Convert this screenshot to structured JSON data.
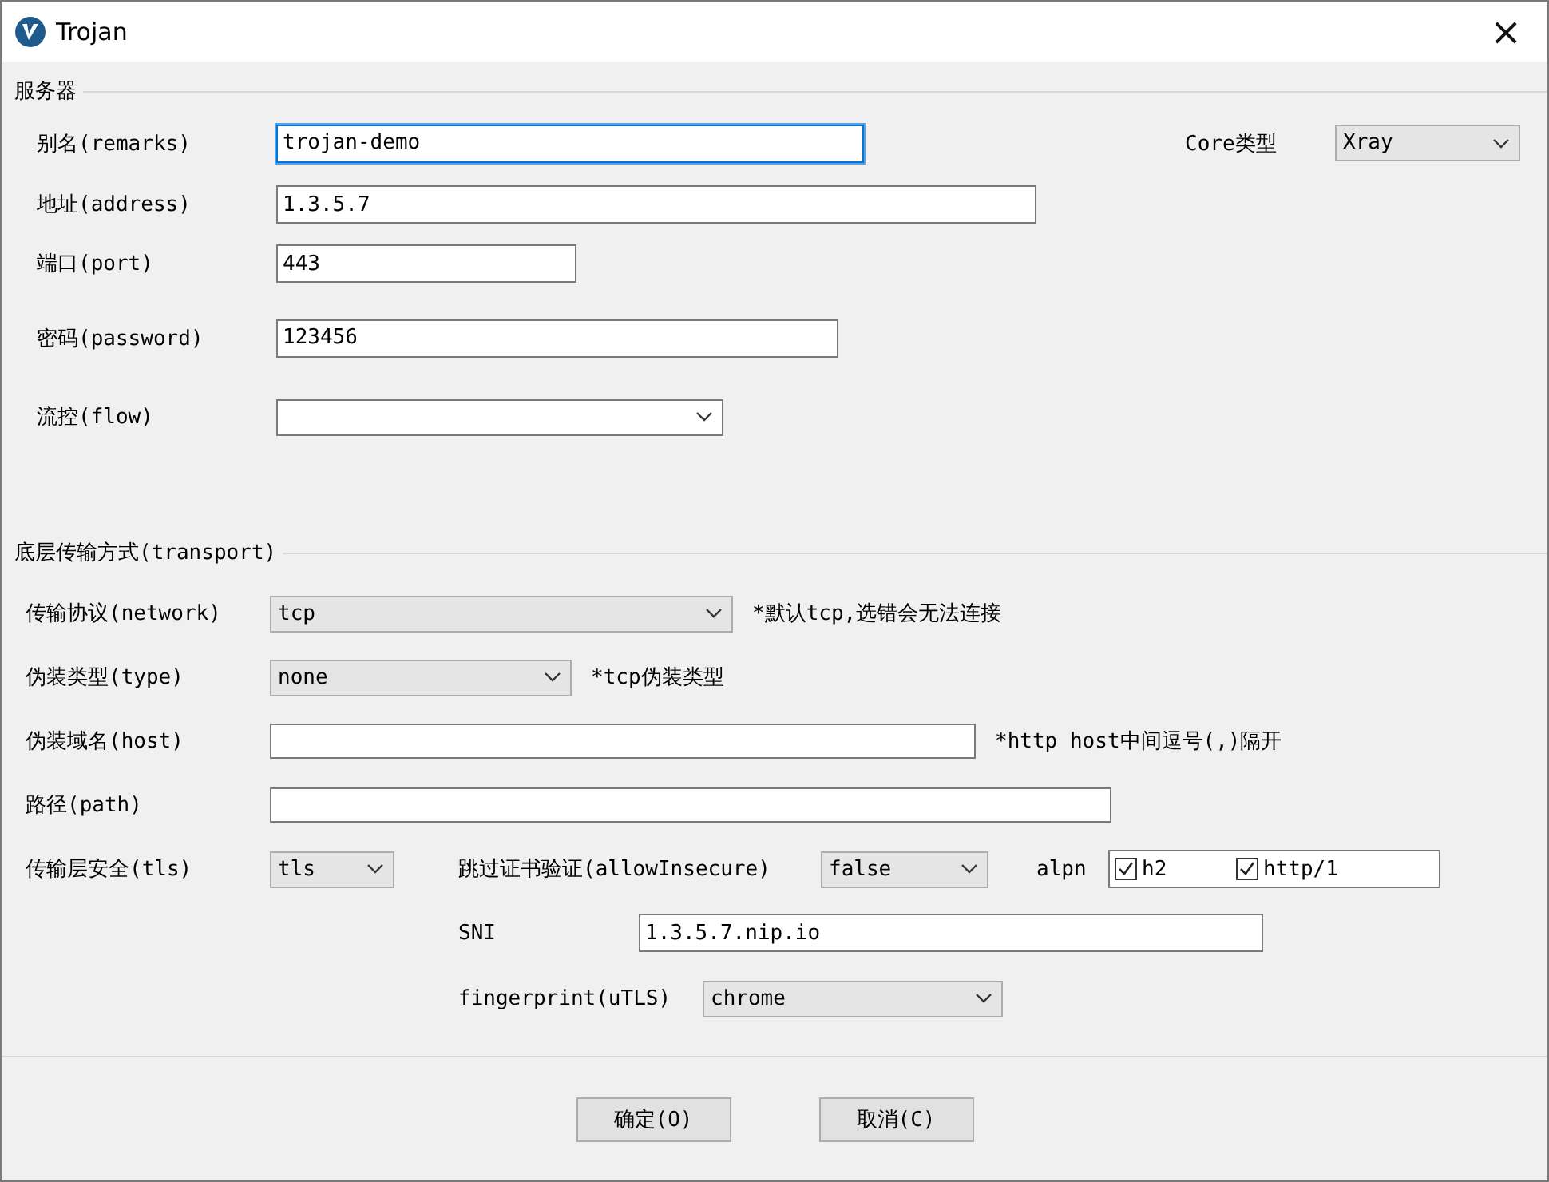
{
  "window": {
    "title": "Trojan",
    "close": "×"
  },
  "server": {
    "title": "服务器",
    "fields": [
      {
        "label": "别名(remarks)",
        "kind": "text",
        "value": "trojan-demo",
        "focused": true
      },
      {
        "label": "地址(address)",
        "kind": "text",
        "value": "1.3.5.7",
        "focused": false
      },
      {
        "label": "端口(port)",
        "kind": "text",
        "value": "443",
        "focused": false
      },
      {
        "label": "密码(password)",
        "kind": "text",
        "value": "123456",
        "focused": false
      },
      {
        "label": "流控(flow)",
        "kind": "combo",
        "focused": false
      }
    ],
    "core": {
      "label": "Core类型",
      "value": "Xray"
    }
  },
  "transport": {
    "title": "底层传输方式(transport)",
    "fields": [
      {
        "label": "传输协议(network)",
        "kind": "select",
        "value": "tcp",
        "note": "*默认tcp,选错会无法连接"
      },
      {
        "label": "伪装类型(type)",
        "kind": "select",
        "value": "none",
        "note": "*tcp伪装类型"
      },
      {
        "label": "伪装域名(host)",
        "kind": "text",
        "note": "*http host中间逗号(,)隔开"
      },
      {
        "label": "路径(path)",
        "kind": "text"
      }
    ],
    "tls": {
      "label": "传输层安全(tls)",
      "value": "tls"
    },
    "allow_insecure": {
      "label": "跳过证书验证(allowInsecure)",
      "value": "false"
    },
    "alpn": {
      "label": "alpn",
      "options": [
        {
          "label": "h2",
          "checked": true
        },
        {
          "label": "http/1",
          "checked": true
        }
      ]
    },
    "sni": {
      "label": "SNI",
      "value": "1.3.5.7.nip.io"
    },
    "fingerprint": {
      "label": "fingerprint(uTLS)",
      "value": "chrome"
    }
  },
  "buttons": [
    "确定(O)",
    "取消(C)"
  ]
}
